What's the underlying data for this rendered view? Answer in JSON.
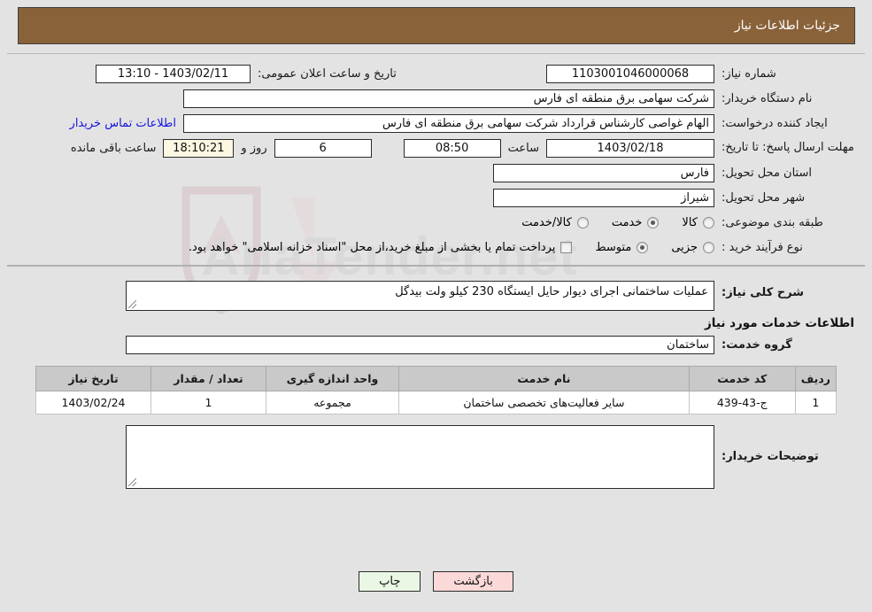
{
  "header": {
    "title": "جزئیات اطلاعات نیاز"
  },
  "form": {
    "need_number_label": "شماره نیاز:",
    "need_number_value": "1103001046000068",
    "announce_label": "تاریخ و ساعت اعلان عمومی:",
    "announce_value": "1403/02/11 - 13:10",
    "buyer_org_label": "نام دستگاه خریدار:",
    "buyer_org_value": "شرکت سهامی برق منطقه ای فارس",
    "creator_label": "ایجاد کننده درخواست:",
    "creator_value": "الهام غواصی کارشناس قرارداد شرکت سهامی برق منطقه ای فارس",
    "contact_link": "اطلاعات تماس خریدار",
    "deadline_label": "مهلت ارسال پاسخ: تا تاریخ:",
    "deadline_date": "1403/02/18",
    "hour_label": "ساعت",
    "deadline_time": "08:50",
    "days_value": "6",
    "days_label": "روز و",
    "remaining_value": "18:10:21",
    "remaining_label": "ساعت باقی مانده",
    "province_label": "استان محل تحویل:",
    "province_value": "فارس",
    "city_label": "شهر محل تحویل:",
    "city_value": "شیراز",
    "category_label": "طبقه بندی موضوعی:",
    "category_options": [
      {
        "label": "کالا",
        "selected": false
      },
      {
        "label": "خدمت",
        "selected": true
      },
      {
        "label": "کالا/خدمت",
        "selected": false
      }
    ],
    "process_label": "نوع فرآیند خرید :",
    "process_options": [
      {
        "label": "جزیی",
        "selected": false
      },
      {
        "label": "متوسط",
        "selected": true
      }
    ],
    "treasury_checkbox_label": "پرداخت تمام یا بخشی از مبلغ خرید،از محل \"اسناد خزانه اسلامی\" خواهد بود.",
    "treasury_checked": false
  },
  "description": {
    "label": "شرح کلی نیاز:",
    "value": "عملیات ساختمانی اجرای دیوار حایل ایستگاه  230 کیلو ولت بیدگل"
  },
  "services": {
    "section_title": "اطلاعات خدمات مورد نیاز",
    "group_label": "گروه خدمت:",
    "group_value": "ساختمان",
    "columns": [
      "ردیف",
      "کد خدمت",
      "نام خدمت",
      "واحد اندازه گیری",
      "تعداد / مقدار",
      "تاریخ نیاز"
    ],
    "rows": [
      [
        "1",
        "ج-43-439",
        "سایر فعالیت‌های تخصصی ساختمان",
        "مجموعه",
        "1",
        "1403/02/24"
      ]
    ]
  },
  "buyer_notes": {
    "label": "توضیحات خریدار:",
    "value": ""
  },
  "footer": {
    "print_label": "چاپ",
    "back_label": "بازگشت"
  },
  "watermark": {
    "text": "AnaTender.net"
  },
  "colors": {
    "header_bg": "#8a6239",
    "link": "#1414dd",
    "print_btn": "#e9f7e4",
    "back_btn": "#fbd9d9",
    "cream_field": "#fbf7e2"
  }
}
